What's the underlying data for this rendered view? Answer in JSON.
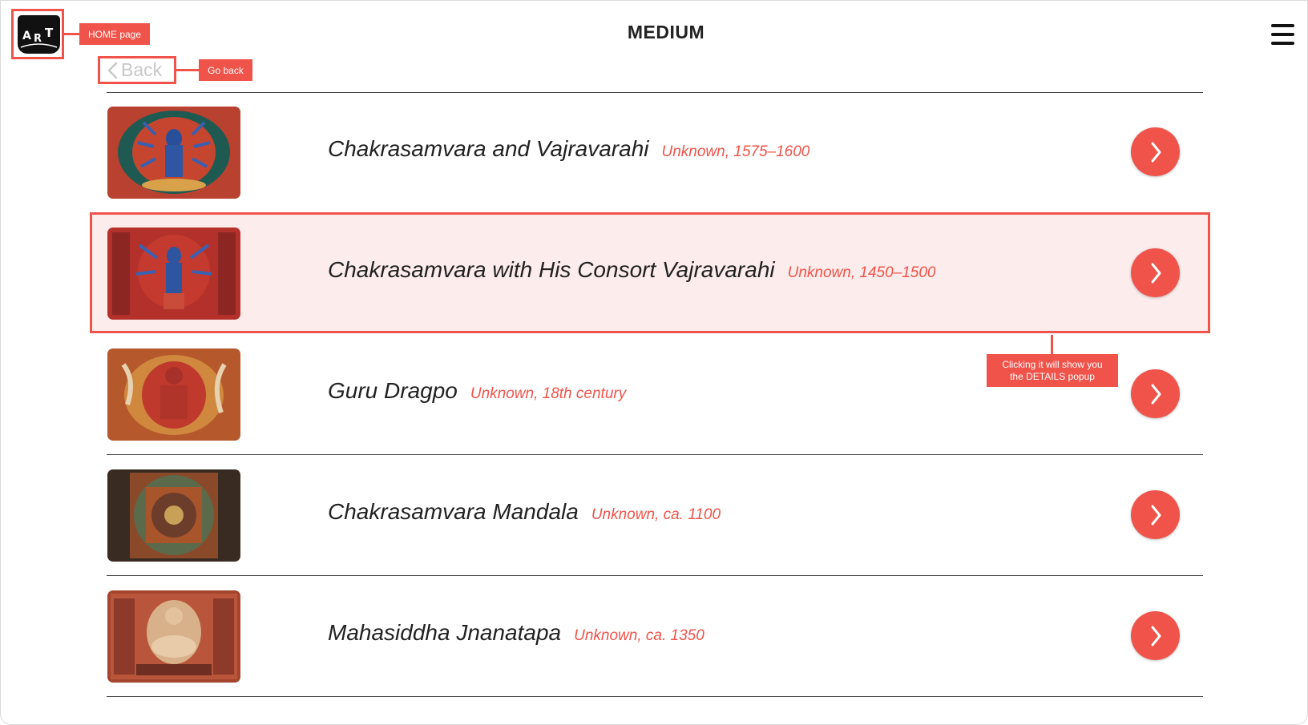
{
  "header": {
    "title": "MEDIUM",
    "back_label": "Back"
  },
  "annotations": {
    "home": "HOME page",
    "back": "Go back",
    "details_line1": "Clicking it will show you",
    "details_line2": "the DETAILS popup"
  },
  "artworks": [
    {
      "title": "Chakrasamvara and Vajravarahi",
      "meta": "Unknown, 1575–1600"
    },
    {
      "title": "Chakrasamvara with His Consort Vajravarahi",
      "meta": "Unknown, 1450–1500"
    },
    {
      "title": "Guru Dragpo",
      "meta": "Unknown, 18th century"
    },
    {
      "title": "Chakrasamvara Mandala",
      "meta": "Unknown, ca. 1100"
    },
    {
      "title": "Mahasiddha Jnanatapa",
      "meta": "Unknown, ca. 1350"
    }
  ],
  "colors": {
    "accent": "#f0534a",
    "highlight_bg": "#fdecec"
  },
  "icons": {
    "logo": "art-book-logo",
    "menu": "hamburger-menu-icon",
    "back": "chevron-left-icon",
    "row_action": "chevron-right-icon"
  }
}
